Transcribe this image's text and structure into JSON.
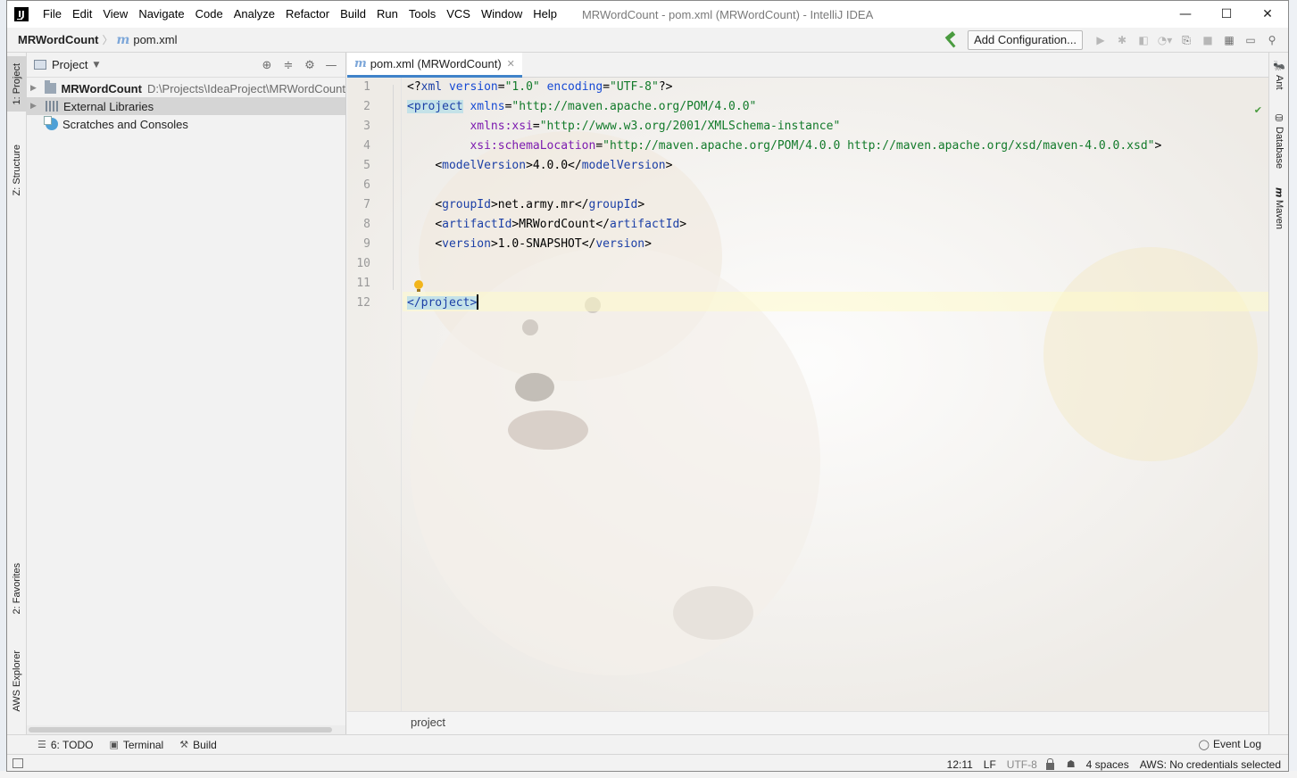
{
  "app": {
    "logo": "IJ",
    "window_title": "MRWordCount - pom.xml (MRWordCount) - IntelliJ IDEA",
    "window_controls": {
      "minimize": "—",
      "maximize": "☐",
      "close": "✕"
    }
  },
  "menu": [
    "File",
    "Edit",
    "View",
    "Navigate",
    "Code",
    "Analyze",
    "Refactor",
    "Build",
    "Run",
    "Tools",
    "VCS",
    "Window",
    "Help"
  ],
  "navbar": {
    "project": "MRWordCount",
    "separator": "〉",
    "file_icon": "m",
    "file": "pom.xml",
    "add_configuration": "Add Configuration..."
  },
  "left_stripe": {
    "tabs": [
      "1: Project",
      "Z: Structure",
      "2: Favorites",
      "AWS Explorer"
    ]
  },
  "project_panel": {
    "title": "Project",
    "tree": [
      {
        "name": "MRWordCount",
        "path": "D:\\Projects\\IdeaProject\\MRWordCount"
      },
      {
        "name": "External Libraries"
      },
      {
        "name": "Scratches and Consoles"
      }
    ]
  },
  "editor": {
    "tab_icon": "m",
    "tab_label": "pom.xml (MRWordCount)",
    "line_numbers": [
      "1",
      "2",
      "3",
      "4",
      "5",
      "6",
      "7",
      "8",
      "9",
      "10",
      "11",
      "12"
    ],
    "code": {
      "l1": {
        "open": "<?",
        "tag": "xml",
        "a1": "version",
        "eq1": "=",
        "v1": "\"1.0\"",
        "a2": "encoding",
        "eq2": "=",
        "v2": "\"UTF-8\"",
        "close": "?>"
      },
      "l2": {
        "tag": "<project",
        "a1": "xmlns",
        "eq1": "=",
        "v1": "\"http://maven.apache.org/POM/4.0.0\""
      },
      "l3": {
        "ns": "xmlns:xsi",
        "eq": "=",
        "v": "\"http://www.w3.org/2001/XMLSchema-instance\""
      },
      "l4": {
        "ns": "xsi:schemaLocation",
        "eq": "=",
        "v": "\"http://maven.apache.org/POM/4.0.0 http://maven.apache.org/xsd/maven-4.0.0.xsd\"",
        "close": ">"
      },
      "l5": {
        "open": "<",
        "tag": "modelVersion",
        "mid": ">",
        "text": "4.0.0",
        "end_open": "</",
        "end_close": ">"
      },
      "l7": {
        "tag": "groupId",
        "text": "net.army.mr"
      },
      "l8": {
        "tag": "artifactId",
        "text": "MRWordCount"
      },
      "l9": {
        "tag": "version",
        "text": "1.0-SNAPSHOT"
      },
      "l12": {
        "tag": "</project>"
      }
    },
    "breadcrumb": "project"
  },
  "right_stripe": {
    "tabs": [
      "Ant",
      "Database",
      "Maven"
    ]
  },
  "bottom_tools": [
    {
      "icon": "☰",
      "label": "6: TODO"
    },
    {
      "icon": "▣",
      "label": "Terminal"
    },
    {
      "icon": "⚒",
      "label": "Build"
    }
  ],
  "event_log": "Event Log",
  "status": {
    "position": "12:11",
    "line_sep": "LF",
    "encoding": "UTF-8",
    "indent": "4 spaces",
    "aws": "AWS: No credentials selected"
  }
}
